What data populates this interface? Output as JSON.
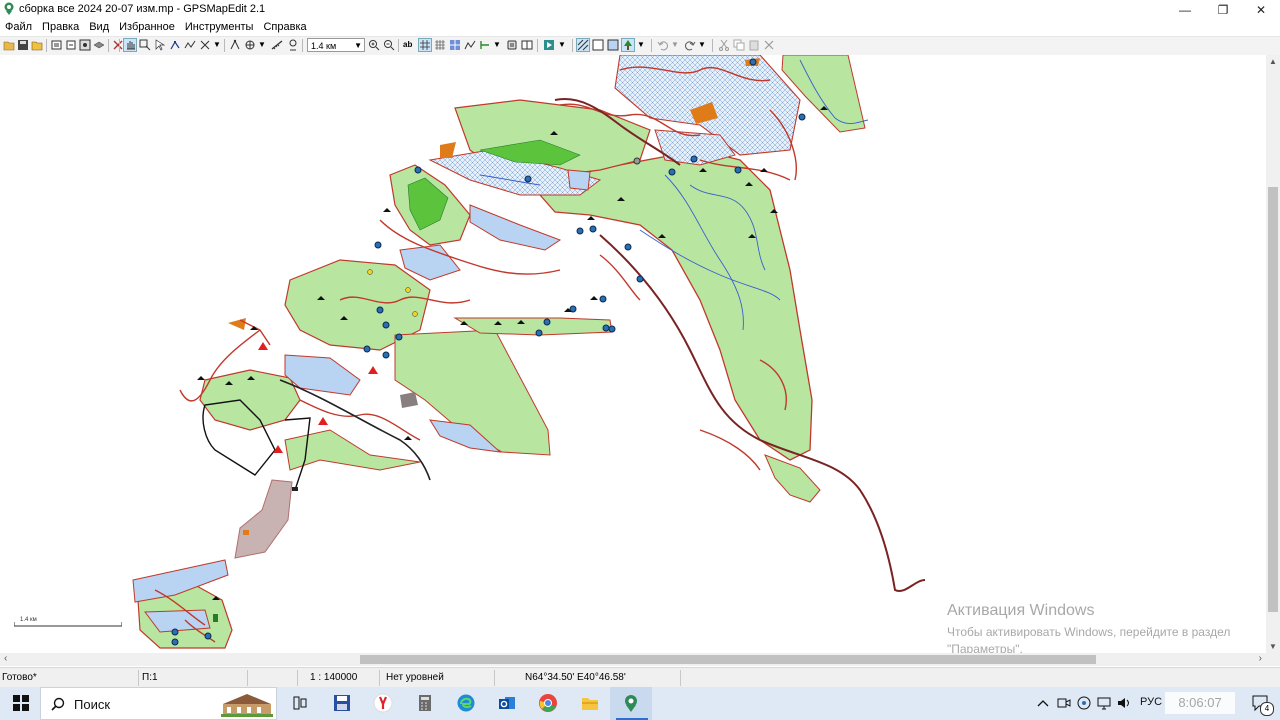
{
  "window": {
    "title": "сборка все 2024 20-07 изм.mp - GPSMapEdit 2.1",
    "controls": [
      "—",
      "❐",
      "✕"
    ]
  },
  "menu": {
    "items": [
      "Файл",
      "Правка",
      "Вид",
      "Избранное",
      "Инструменты",
      "Справка"
    ]
  },
  "toolbar": {
    "scale_value": "1.4 км",
    "label_tool": "ab"
  },
  "map": {
    "scalebar_label": "1.4 км",
    "colors": {
      "land": "#b8e6a0",
      "contour": "#c0392b",
      "water": "#b9d3f2",
      "road": "#7a2323",
      "river": "#3a5fcd",
      "forest": "#5cc43c",
      "sand": "#e07b1a",
      "settlement": "#c8b2b2"
    }
  },
  "watermark": {
    "line1": "Активация Windows",
    "line2": "Чтобы активировать Windows, перейдите в раздел",
    "line3": "\"Параметры\"."
  },
  "status": {
    "ready": "Готово*",
    "page": "П:1",
    "scale": "1 : 140000",
    "levels": "Нет уровней",
    "coords": "N64°34.50' E40°46.58'"
  },
  "taskbar": {
    "search_placeholder": "Поиск",
    "lang": "РУС",
    "time": "8:06:07",
    "notification_count": "4"
  }
}
